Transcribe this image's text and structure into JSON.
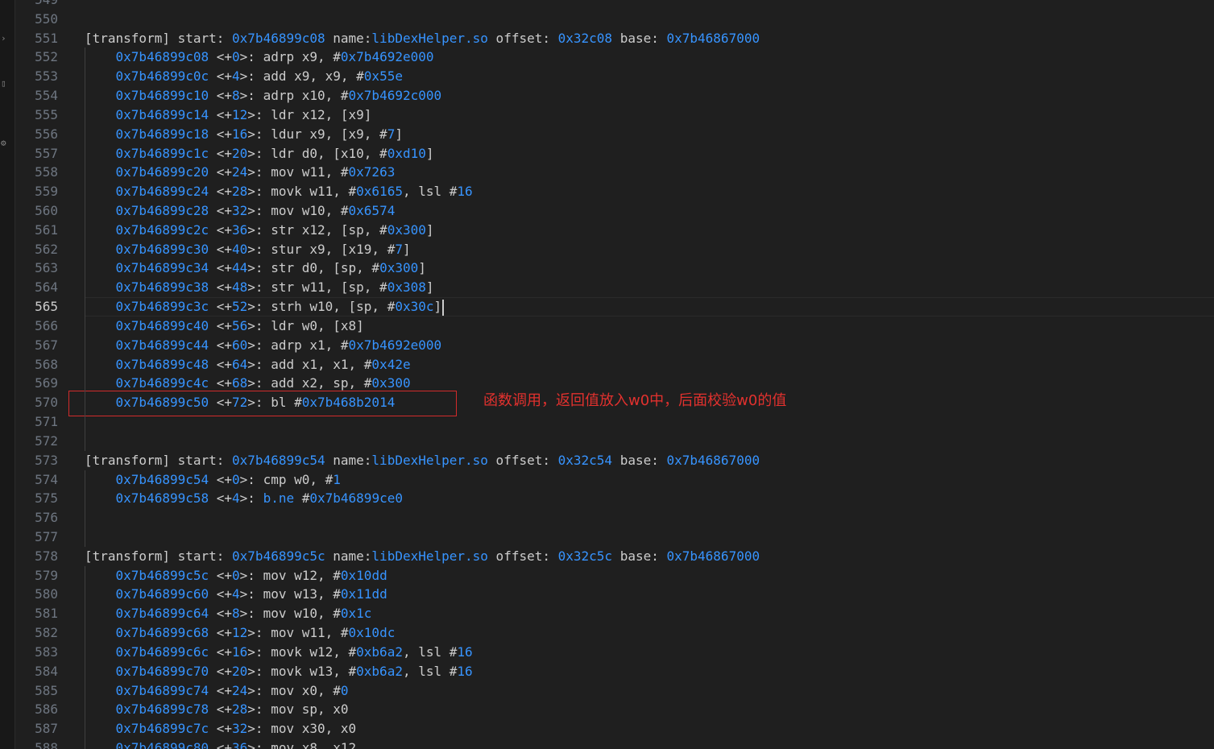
{
  "line_numbers": [
    "549",
    "550",
    "551",
    "552",
    "553",
    "554",
    "555",
    "556",
    "557",
    "558",
    "559",
    "560",
    "561",
    "562",
    "563",
    "564",
    "565",
    "566",
    "567",
    "568",
    "569",
    "570",
    "571",
    "572",
    "573",
    "574",
    "575",
    "576",
    "577",
    "578",
    "579",
    "580",
    "581",
    "582",
    "583",
    "584",
    "585",
    "586",
    "587",
    "588"
  ],
  "active_line": "565",
  "activity_icons": [
    "chevron-right-icon",
    "explorer-icon",
    "gear-icon"
  ],
  "lines": [
    [
      {
        "t": "",
        "c": "txt"
      }
    ],
    [
      {
        "t": "",
        "c": "txt"
      }
    ],
    [
      {
        "t": "[transform] start: ",
        "c": "txt"
      },
      {
        "t": "0x7b46899c08",
        "c": "blue"
      },
      {
        "t": " name:",
        "c": "txt"
      },
      {
        "t": "libDexHelper.so",
        "c": "blue"
      },
      {
        "t": " offset: ",
        "c": "txt"
      },
      {
        "t": "0x32c08",
        "c": "blue"
      },
      {
        "t": " base: ",
        "c": "txt"
      },
      {
        "t": "0x7b46867000",
        "c": "blue"
      }
    ],
    [
      {
        "t": "    ",
        "c": "txt"
      },
      {
        "t": "0x7b46899c08",
        "c": "blue"
      },
      {
        "t": " <+",
        "c": "txt"
      },
      {
        "t": "0",
        "c": "blue"
      },
      {
        "t": ">: adrp x9, #",
        "c": "txt"
      },
      {
        "t": "0x7b4692e000",
        "c": "blue"
      }
    ],
    [
      {
        "t": "    ",
        "c": "txt"
      },
      {
        "t": "0x7b46899c0c",
        "c": "blue"
      },
      {
        "t": " <+",
        "c": "txt"
      },
      {
        "t": "4",
        "c": "blue"
      },
      {
        "t": ">: add x9, x9, #",
        "c": "txt"
      },
      {
        "t": "0x55e",
        "c": "blue"
      }
    ],
    [
      {
        "t": "    ",
        "c": "txt"
      },
      {
        "t": "0x7b46899c10",
        "c": "blue"
      },
      {
        "t": " <+",
        "c": "txt"
      },
      {
        "t": "8",
        "c": "blue"
      },
      {
        "t": ">: adrp x10, #",
        "c": "txt"
      },
      {
        "t": "0x7b4692c000",
        "c": "blue"
      }
    ],
    [
      {
        "t": "    ",
        "c": "txt"
      },
      {
        "t": "0x7b46899c14",
        "c": "blue"
      },
      {
        "t": " <+",
        "c": "txt"
      },
      {
        "t": "12",
        "c": "blue"
      },
      {
        "t": ">: ldr x12, [x9]",
        "c": "txt"
      }
    ],
    [
      {
        "t": "    ",
        "c": "txt"
      },
      {
        "t": "0x7b46899c18",
        "c": "blue"
      },
      {
        "t": " <+",
        "c": "txt"
      },
      {
        "t": "16",
        "c": "blue"
      },
      {
        "t": ">: ldur x9, [x9, #",
        "c": "txt"
      },
      {
        "t": "7",
        "c": "blue"
      },
      {
        "t": "]",
        "c": "txt"
      }
    ],
    [
      {
        "t": "    ",
        "c": "txt"
      },
      {
        "t": "0x7b46899c1c",
        "c": "blue"
      },
      {
        "t": " <+",
        "c": "txt"
      },
      {
        "t": "20",
        "c": "blue"
      },
      {
        "t": ">: ldr d0, [x10, #",
        "c": "txt"
      },
      {
        "t": "0xd10",
        "c": "blue"
      },
      {
        "t": "]",
        "c": "txt"
      }
    ],
    [
      {
        "t": "    ",
        "c": "txt"
      },
      {
        "t": "0x7b46899c20",
        "c": "blue"
      },
      {
        "t": " <+",
        "c": "txt"
      },
      {
        "t": "24",
        "c": "blue"
      },
      {
        "t": ">: mov w11, #",
        "c": "txt"
      },
      {
        "t": "0x7263",
        "c": "blue"
      }
    ],
    [
      {
        "t": "    ",
        "c": "txt"
      },
      {
        "t": "0x7b46899c24",
        "c": "blue"
      },
      {
        "t": " <+",
        "c": "txt"
      },
      {
        "t": "28",
        "c": "blue"
      },
      {
        "t": ">: movk w11, #",
        "c": "txt"
      },
      {
        "t": "0x6165",
        "c": "blue"
      },
      {
        "t": ", lsl #",
        "c": "txt"
      },
      {
        "t": "16",
        "c": "blue"
      }
    ],
    [
      {
        "t": "    ",
        "c": "txt"
      },
      {
        "t": "0x7b46899c28",
        "c": "blue"
      },
      {
        "t": " <+",
        "c": "txt"
      },
      {
        "t": "32",
        "c": "blue"
      },
      {
        "t": ">: mov w10, #",
        "c": "txt"
      },
      {
        "t": "0x6574",
        "c": "blue"
      }
    ],
    [
      {
        "t": "    ",
        "c": "txt"
      },
      {
        "t": "0x7b46899c2c",
        "c": "blue"
      },
      {
        "t": " <+",
        "c": "txt"
      },
      {
        "t": "36",
        "c": "blue"
      },
      {
        "t": ">: str x12, [sp, #",
        "c": "txt"
      },
      {
        "t": "0x300",
        "c": "blue"
      },
      {
        "t": "]",
        "c": "txt"
      }
    ],
    [
      {
        "t": "    ",
        "c": "txt"
      },
      {
        "t": "0x7b46899c30",
        "c": "blue"
      },
      {
        "t": " <+",
        "c": "txt"
      },
      {
        "t": "40",
        "c": "blue"
      },
      {
        "t": ">: stur x9, [x19, #",
        "c": "txt"
      },
      {
        "t": "7",
        "c": "blue"
      },
      {
        "t": "]",
        "c": "txt"
      }
    ],
    [
      {
        "t": "    ",
        "c": "txt"
      },
      {
        "t": "0x7b46899c34",
        "c": "blue"
      },
      {
        "t": " <+",
        "c": "txt"
      },
      {
        "t": "44",
        "c": "blue"
      },
      {
        "t": ">: str d0, [sp, #",
        "c": "txt"
      },
      {
        "t": "0x300",
        "c": "blue"
      },
      {
        "t": "]",
        "c": "txt"
      }
    ],
    [
      {
        "t": "    ",
        "c": "txt"
      },
      {
        "t": "0x7b46899c38",
        "c": "blue"
      },
      {
        "t": " <+",
        "c": "txt"
      },
      {
        "t": "48",
        "c": "blue"
      },
      {
        "t": ">: str w11, [sp, #",
        "c": "txt"
      },
      {
        "t": "0x308",
        "c": "blue"
      },
      {
        "t": "]",
        "c": "txt"
      }
    ],
    [
      {
        "t": "    ",
        "c": "txt"
      },
      {
        "t": "0x7b46899c3c",
        "c": "blue"
      },
      {
        "t": " <+",
        "c": "txt"
      },
      {
        "t": "52",
        "c": "blue"
      },
      {
        "t": ">: strh w10, [sp, #",
        "c": "txt"
      },
      {
        "t": "0x30c",
        "c": "blue"
      },
      {
        "t": "]",
        "c": "txt"
      }
    ],
    [
      {
        "t": "    ",
        "c": "txt"
      },
      {
        "t": "0x7b46899c40",
        "c": "blue"
      },
      {
        "t": " <+",
        "c": "txt"
      },
      {
        "t": "56",
        "c": "blue"
      },
      {
        "t": ">: ldr w0, [x8]",
        "c": "txt"
      }
    ],
    [
      {
        "t": "    ",
        "c": "txt"
      },
      {
        "t": "0x7b46899c44",
        "c": "blue"
      },
      {
        "t": " <+",
        "c": "txt"
      },
      {
        "t": "60",
        "c": "blue"
      },
      {
        "t": ">: adrp x1, #",
        "c": "txt"
      },
      {
        "t": "0x7b4692e000",
        "c": "blue"
      }
    ],
    [
      {
        "t": "    ",
        "c": "txt"
      },
      {
        "t": "0x7b46899c48",
        "c": "blue"
      },
      {
        "t": " <+",
        "c": "txt"
      },
      {
        "t": "64",
        "c": "blue"
      },
      {
        "t": ">: add x1, x1, #",
        "c": "txt"
      },
      {
        "t": "0x42e",
        "c": "blue"
      }
    ],
    [
      {
        "t": "    ",
        "c": "txt"
      },
      {
        "t": "0x7b46899c4c",
        "c": "blue"
      },
      {
        "t": " <+",
        "c": "txt"
      },
      {
        "t": "68",
        "c": "blue"
      },
      {
        "t": ">: add x2, sp, #",
        "c": "txt"
      },
      {
        "t": "0x300",
        "c": "blue"
      }
    ],
    [
      {
        "t": "    ",
        "c": "txt"
      },
      {
        "t": "0x7b46899c50",
        "c": "blue"
      },
      {
        "t": " <+",
        "c": "txt"
      },
      {
        "t": "72",
        "c": "blue"
      },
      {
        "t": ">: bl #",
        "c": "txt"
      },
      {
        "t": "0x7b468b2014",
        "c": "blue"
      }
    ],
    [
      {
        "t": "",
        "c": "txt"
      }
    ],
    [
      {
        "t": "",
        "c": "txt"
      }
    ],
    [
      {
        "t": "[transform] start: ",
        "c": "txt"
      },
      {
        "t": "0x7b46899c54",
        "c": "blue"
      },
      {
        "t": " name:",
        "c": "txt"
      },
      {
        "t": "libDexHelper.so",
        "c": "blue"
      },
      {
        "t": " offset: ",
        "c": "txt"
      },
      {
        "t": "0x32c54",
        "c": "blue"
      },
      {
        "t": " base: ",
        "c": "txt"
      },
      {
        "t": "0x7b46867000",
        "c": "blue"
      }
    ],
    [
      {
        "t": "    ",
        "c": "txt"
      },
      {
        "t": "0x7b46899c54",
        "c": "blue"
      },
      {
        "t": " <+",
        "c": "txt"
      },
      {
        "t": "0",
        "c": "blue"
      },
      {
        "t": ">: cmp w0, #",
        "c": "txt"
      },
      {
        "t": "1",
        "c": "blue"
      }
    ],
    [
      {
        "t": "    ",
        "c": "txt"
      },
      {
        "t": "0x7b46899c58",
        "c": "blue"
      },
      {
        "t": " <+",
        "c": "txt"
      },
      {
        "t": "4",
        "c": "blue"
      },
      {
        "t": ">: ",
        "c": "txt"
      },
      {
        "t": "b.ne",
        "c": "blue"
      },
      {
        "t": " #",
        "c": "txt"
      },
      {
        "t": "0x7b46899ce0",
        "c": "blue"
      }
    ],
    [
      {
        "t": "",
        "c": "txt"
      }
    ],
    [
      {
        "t": "",
        "c": "txt"
      }
    ],
    [
      {
        "t": "[transform] start: ",
        "c": "txt"
      },
      {
        "t": "0x7b46899c5c",
        "c": "blue"
      },
      {
        "t": " name:",
        "c": "txt"
      },
      {
        "t": "libDexHelper.so",
        "c": "blue"
      },
      {
        "t": " offset: ",
        "c": "txt"
      },
      {
        "t": "0x32c5c",
        "c": "blue"
      },
      {
        "t": " base: ",
        "c": "txt"
      },
      {
        "t": "0x7b46867000",
        "c": "blue"
      }
    ],
    [
      {
        "t": "    ",
        "c": "txt"
      },
      {
        "t": "0x7b46899c5c",
        "c": "blue"
      },
      {
        "t": " <+",
        "c": "txt"
      },
      {
        "t": "0",
        "c": "blue"
      },
      {
        "t": ">: mov w12, #",
        "c": "txt"
      },
      {
        "t": "0x10dd",
        "c": "blue"
      }
    ],
    [
      {
        "t": "    ",
        "c": "txt"
      },
      {
        "t": "0x7b46899c60",
        "c": "blue"
      },
      {
        "t": " <+",
        "c": "txt"
      },
      {
        "t": "4",
        "c": "blue"
      },
      {
        "t": ">: mov w13, #",
        "c": "txt"
      },
      {
        "t": "0x11dd",
        "c": "blue"
      }
    ],
    [
      {
        "t": "    ",
        "c": "txt"
      },
      {
        "t": "0x7b46899c64",
        "c": "blue"
      },
      {
        "t": " <+",
        "c": "txt"
      },
      {
        "t": "8",
        "c": "blue"
      },
      {
        "t": ">: mov w10, #",
        "c": "txt"
      },
      {
        "t": "0x1c",
        "c": "blue"
      }
    ],
    [
      {
        "t": "    ",
        "c": "txt"
      },
      {
        "t": "0x7b46899c68",
        "c": "blue"
      },
      {
        "t": " <+",
        "c": "txt"
      },
      {
        "t": "12",
        "c": "blue"
      },
      {
        "t": ">: mov w11, #",
        "c": "txt"
      },
      {
        "t": "0x10dc",
        "c": "blue"
      }
    ],
    [
      {
        "t": "    ",
        "c": "txt"
      },
      {
        "t": "0x7b46899c6c",
        "c": "blue"
      },
      {
        "t": " <+",
        "c": "txt"
      },
      {
        "t": "16",
        "c": "blue"
      },
      {
        "t": ">: movk w12, #",
        "c": "txt"
      },
      {
        "t": "0xb6a2",
        "c": "blue"
      },
      {
        "t": ", lsl #",
        "c": "txt"
      },
      {
        "t": "16",
        "c": "blue"
      }
    ],
    [
      {
        "t": "    ",
        "c": "txt"
      },
      {
        "t": "0x7b46899c70",
        "c": "blue"
      },
      {
        "t": " <+",
        "c": "txt"
      },
      {
        "t": "20",
        "c": "blue"
      },
      {
        "t": ">: movk w13, #",
        "c": "txt"
      },
      {
        "t": "0xb6a2",
        "c": "blue"
      },
      {
        "t": ", lsl #",
        "c": "txt"
      },
      {
        "t": "16",
        "c": "blue"
      }
    ],
    [
      {
        "t": "    ",
        "c": "txt"
      },
      {
        "t": "0x7b46899c74",
        "c": "blue"
      },
      {
        "t": " <+",
        "c": "txt"
      },
      {
        "t": "24",
        "c": "blue"
      },
      {
        "t": ">: mov x0, #",
        "c": "txt"
      },
      {
        "t": "0",
        "c": "blue"
      }
    ],
    [
      {
        "t": "    ",
        "c": "txt"
      },
      {
        "t": "0x7b46899c78",
        "c": "blue"
      },
      {
        "t": " <+",
        "c": "txt"
      },
      {
        "t": "28",
        "c": "blue"
      },
      {
        "t": ">: mov sp, x0",
        "c": "txt"
      }
    ],
    [
      {
        "t": "    ",
        "c": "txt"
      },
      {
        "t": "0x7b46899c7c",
        "c": "blue"
      },
      {
        "t": " <+",
        "c": "txt"
      },
      {
        "t": "32",
        "c": "blue"
      },
      {
        "t": ">: mov x30, x0",
        "c": "txt"
      }
    ],
    [
      {
        "t": "    ",
        "c": "txt"
      },
      {
        "t": "0x7b46899c80",
        "c": "blue"
      },
      {
        "t": " <+",
        "c": "txt"
      },
      {
        "t": "36",
        "c": "blue"
      },
      {
        "t": ">: mov x8, x12",
        "c": "txt"
      }
    ]
  ],
  "annotation": {
    "text": "函数调用，返回值放入w0中，后面校验w0的值",
    "color": "#e2312e"
  },
  "colors": {
    "background": "#1f1f1f",
    "text": "#cccccc",
    "hex_value": "#3794ff",
    "line_number": "#6e7681",
    "annotation": "#e2312e"
  }
}
